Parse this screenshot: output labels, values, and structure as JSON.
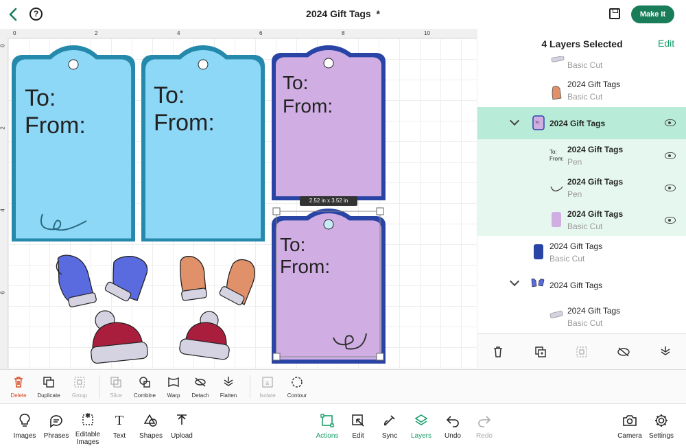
{
  "header": {
    "title": "2024 Gift Tags",
    "unsaved_marker": "*",
    "make_it_label": "Make It",
    "back_icon": "chevron-left-icon",
    "help_icon": "question-circle-icon",
    "save_icon": "save-icon",
    "accent_color": "#1a7d5a"
  },
  "canvas": {
    "ruler_top_labels": [
      "0",
      "2",
      "4",
      "6",
      "8",
      "10"
    ],
    "ruler_left_labels": [
      "0",
      "2",
      "4",
      "6"
    ],
    "selection_dimensions": "2.52 in x 3.52 in",
    "tag_text_to": "To:",
    "tag_text_from": "From:",
    "colors": {
      "blue_tag_fill": "#8dd8f6",
      "blue_tag_border": "#2589ac",
      "purple_tag_fill": "#d0aee3",
      "purple_tag_border": "#2a44a6",
      "mitten_blue": "#5a6be0",
      "mitten_orange": "#e0916a",
      "hat_red": "#a81e3c",
      "hat_band": "#d5d3e2"
    }
  },
  "layers_panel": {
    "title": "4 Layers Selected",
    "edit_label": "Edit",
    "rows": [
      {
        "name": "",
        "sub": "Basic Cut"
      },
      {
        "name": "2024 Gift Tags",
        "sub": "Basic Cut"
      },
      {
        "name": "2024 Gift Tags",
        "sub": ""
      },
      {
        "name": "2024 Gift Tags",
        "sub": "Pen"
      },
      {
        "name": "2024 Gift Tags",
        "sub": "Pen"
      },
      {
        "name": "2024 Gift Tags",
        "sub": "Basic Cut"
      },
      {
        "name": "2024 Gift Tags",
        "sub": "Basic Cut"
      },
      {
        "name": "2024 Gift Tags",
        "sub": ""
      },
      {
        "name": "2024 Gift Tags",
        "sub": "Basic Cut"
      }
    ],
    "toolbar_icons": [
      "trash-icon",
      "duplicate-icon",
      "group-icon",
      "hide-icon",
      "flatten-icon"
    ]
  },
  "edit_toolbar": {
    "items": [
      {
        "label": "Delete"
      },
      {
        "label": "Duplicate"
      },
      {
        "label": "Group"
      },
      {
        "label": "Slice"
      },
      {
        "label": "Combine"
      },
      {
        "label": "Warp"
      },
      {
        "label": "Detach"
      },
      {
        "label": "Flatten"
      },
      {
        "label": "Isolate"
      },
      {
        "label": "Contour"
      }
    ]
  },
  "bottom_nav": {
    "left": [
      {
        "label": "Images"
      },
      {
        "label": "Phrases"
      },
      {
        "label": "Editable Images"
      },
      {
        "label": "Text"
      },
      {
        "label": "Shapes"
      },
      {
        "label": "Upload"
      }
    ],
    "center": [
      {
        "label": "Actions"
      },
      {
        "label": "Edit"
      },
      {
        "label": "Sync"
      },
      {
        "label": "Layers"
      },
      {
        "label": "Undo"
      },
      {
        "label": "Redo"
      }
    ],
    "right": [
      {
        "label": "Camera"
      },
      {
        "label": "Settings"
      }
    ]
  }
}
